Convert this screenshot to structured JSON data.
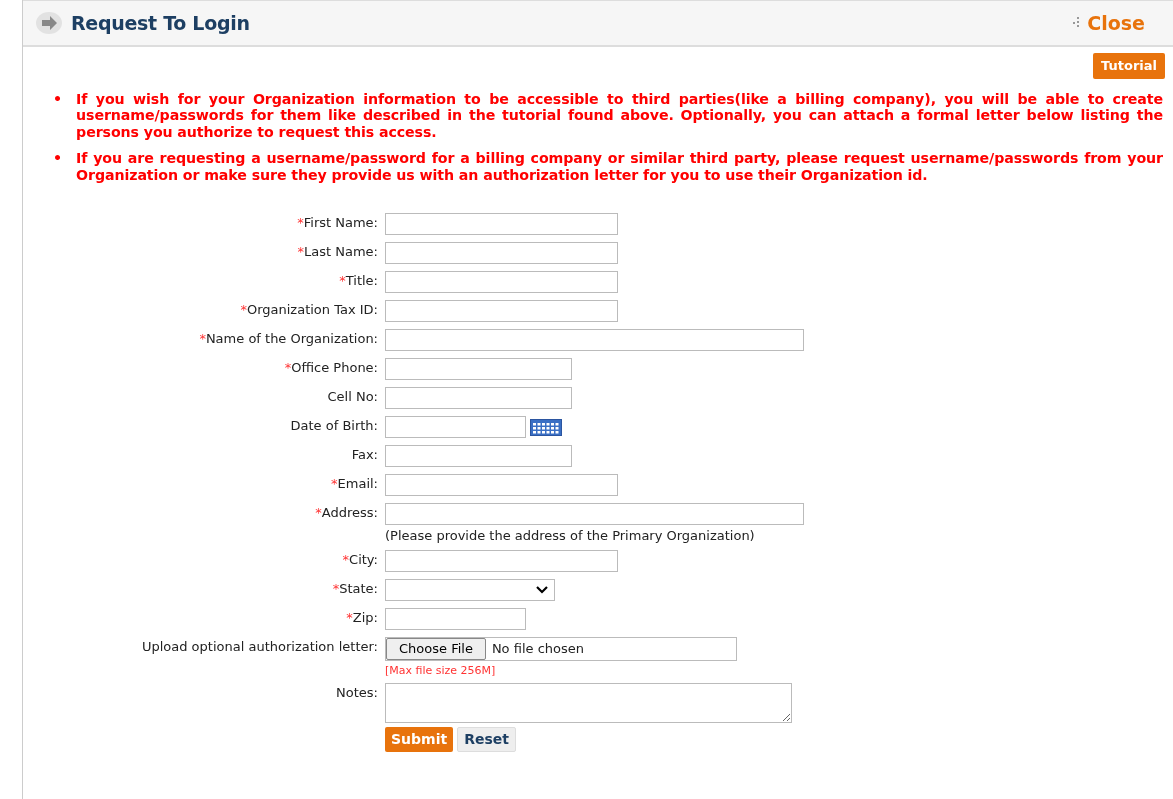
{
  "window": {
    "title": "Request To Login",
    "close": "Close"
  },
  "tutorial_button": "Tutorial",
  "notices": [
    {
      "bullet": "•",
      "text": "If you wish for your Organization information to be accessible to third parties(like a billing company), you will be able to create username/passwords for them like described in the tutorial found above. Optionally, you can attach a formal letter below listing the persons you authorize to request this access."
    },
    {
      "bullet": "•",
      "text": "If you are requesting a username/password for a billing company or similar third party, please request username/passwords from your Organization or make sure they provide us with an authorization letter for you to use their Organization id."
    }
  ],
  "fields": [
    {
      "kind": "text",
      "required_mark": "*",
      "label": "First Name:"
    },
    {
      "kind": "text",
      "required_mark": "*",
      "label": "Last Name:"
    },
    {
      "kind": "text",
      "required_mark": "*",
      "label": "Title:"
    },
    {
      "kind": "text",
      "required_mark": "*",
      "label": "Organization Tax ID:"
    },
    {
      "kind": "wide",
      "required_mark": "*",
      "label": "Name of the Organization:"
    },
    {
      "kind": "short",
      "required_mark": "*",
      "label": "Office Phone:"
    },
    {
      "kind": "short",
      "label": "Cell No:"
    },
    {
      "kind": "date",
      "label": "Date of Birth:"
    },
    {
      "kind": "short",
      "label": "Fax:"
    },
    {
      "kind": "text",
      "required_mark": "*",
      "label": "Email:"
    },
    {
      "kind": "wide",
      "required_mark": "*",
      "label": "Address:",
      "hint": "(Please provide the address of the Primary Organization)"
    },
    {
      "kind": "text",
      "required_mark": "*",
      "label": "City:"
    },
    {
      "kind": "select",
      "required_mark": "*",
      "label": "State:"
    },
    {
      "kind": "tiny",
      "required_mark": "*",
      "label": "Zip:"
    },
    {
      "kind": "file",
      "label": "Upload optional authorization letter:",
      "button": "Choose File",
      "status": "No file chosen",
      "note": "[Max file size 256M]"
    },
    {
      "kind": "textarea",
      "label": "Notes:"
    }
  ],
  "buttons": [
    {
      "kind": "primary",
      "label": "Submit"
    },
    {
      "kind": "secondary",
      "label": "Reset"
    }
  ]
}
